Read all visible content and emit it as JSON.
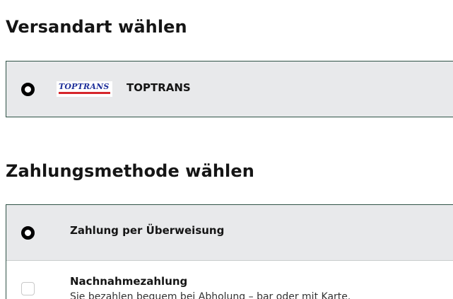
{
  "shipping": {
    "title": "Versandart wählen",
    "options": [
      {
        "label": "TOPTRANS",
        "logo_text": "TOPTRANS",
        "selected": true
      }
    ]
  },
  "payment": {
    "title": "Zahlungsmethode wählen",
    "options": [
      {
        "label": "Zahlung per Überweisung",
        "selected": true
      },
      {
        "label": "Nachnahmezahlung",
        "description": "Sie bezahlen bequem bei Abholung – bar oder mit Karte.",
        "selected": false
      }
    ]
  },
  "colors": {
    "selected_background": "#e8e9eb",
    "border": "#2f5246",
    "logo_blue": "#1e2f9a",
    "logo_red": "#d6262b"
  },
  "icons": {
    "radio_checked": "radio-checked-icon",
    "radio_unchecked": "radio-unchecked-icon"
  }
}
